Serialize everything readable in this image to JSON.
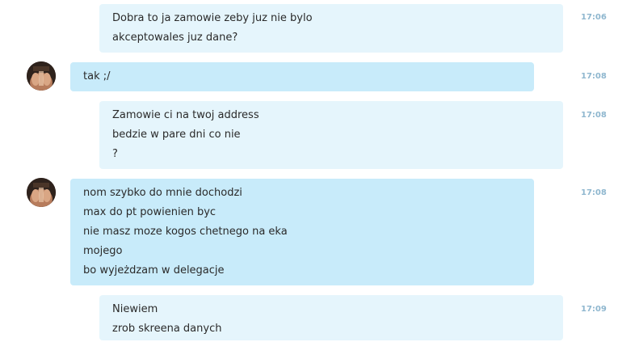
{
  "messages": [
    {
      "sender": "self",
      "time": "17:06",
      "lines": [
        "Dobra to ja zamowie zeby juz nie bylo",
        "akceptowales juz dane?"
      ]
    },
    {
      "sender": "other",
      "time": "17:08",
      "lines": [
        "tak ;/"
      ]
    },
    {
      "sender": "self",
      "time": "17:08",
      "lines": [
        "Zamowie ci na twoj address",
        "bedzie w pare dni co nie",
        "?"
      ]
    },
    {
      "sender": "other",
      "time": "17:08",
      "lines": [
        "nom szybko do mnie dochodzi",
        "max do pt powienien byc",
        "nie masz moze kogos chetnego na eka",
        "mojego",
        "bo wyjeżdzam w delegacje"
      ]
    },
    {
      "sender": "self",
      "time": "17:09",
      "lines": [
        "Niewiem",
        "zrob skreena danych"
      ]
    }
  ],
  "colors": {
    "self_bubble": "#e5f5fc",
    "other_bubble": "#c8ebfa",
    "timestamp": "#8fb7cf",
    "text": "#2a2a2a"
  },
  "icons": {
    "avatar": "contact-avatar-photo"
  }
}
